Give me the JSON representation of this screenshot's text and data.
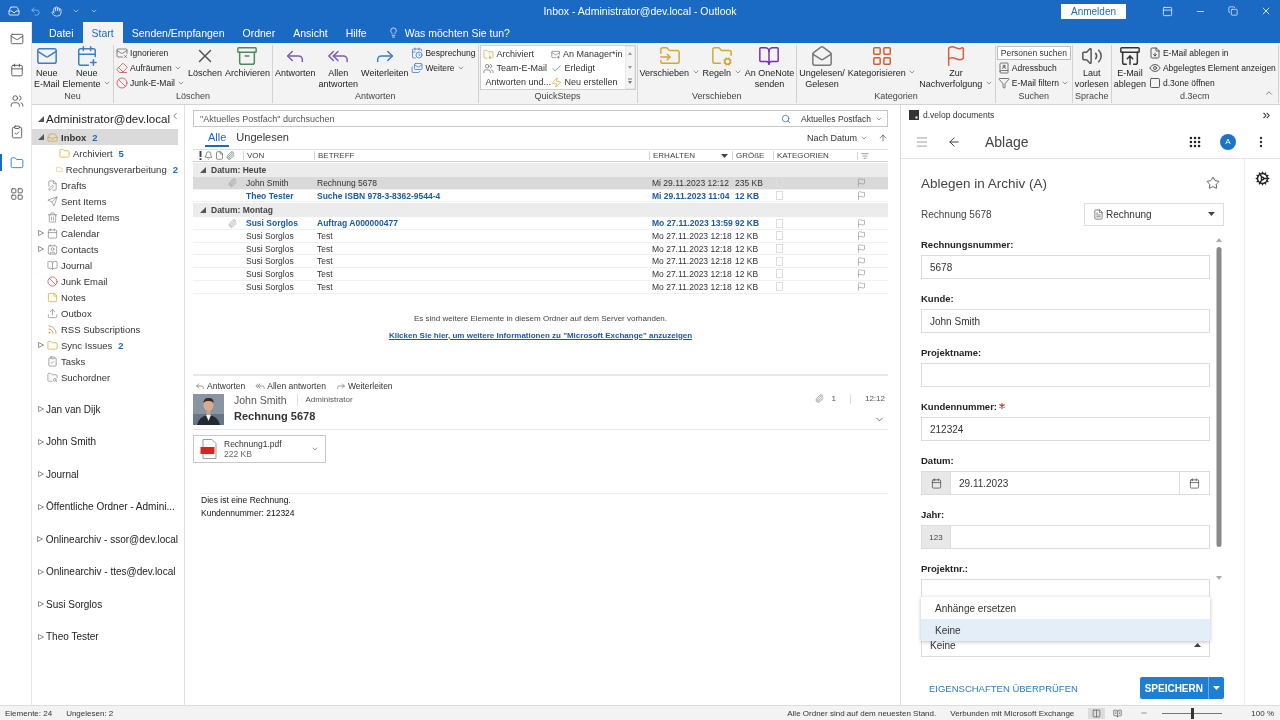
{
  "title_bar": {
    "title": "Inbox - Administrator@dev.local - Outlook",
    "sign_in": "Anmelden"
  },
  "ribbon": {
    "tabs": [
      {
        "label": "Datei",
        "selected": false
      },
      {
        "label": "Start",
        "selected": true
      },
      {
        "label": "Senden/Empfangen",
        "selected": false
      },
      {
        "label": "Ordner",
        "selected": false
      },
      {
        "label": "Ansicht",
        "selected": false
      },
      {
        "label": "Hilfe",
        "selected": false
      }
    ],
    "tell_me": "Was möchten Sie tun?",
    "groups": [
      {
        "name": "Neu",
        "items": [
          {
            "kind": "large",
            "label": "Neue\nE-Mail"
          },
          {
            "kind": "large",
            "label": "Neue\nElemente",
            "dropdown": true
          }
        ]
      },
      {
        "name": "Löschen",
        "items": [
          {
            "kind": "stack",
            "items": [
              {
                "label": "Ignorieren"
              },
              {
                "label": "Aufräumen",
                "dropdown": true
              },
              {
                "label": "Junk-E-Mail",
                "dropdown": true
              }
            ]
          },
          {
            "kind": "large",
            "label": "Löschen"
          },
          {
            "kind": "large",
            "label": "Archivieren"
          }
        ]
      },
      {
        "name": "Antworten",
        "items": [
          {
            "kind": "large",
            "label": "Antworten"
          },
          {
            "kind": "large",
            "label": "Allen\nantworten"
          },
          {
            "kind": "large",
            "label": "Weiterleiten"
          },
          {
            "kind": "stack",
            "items": [
              {
                "label": "Besprechung"
              },
              {
                "label": "Weitere",
                "dropdown": true
              }
            ]
          }
        ]
      },
      {
        "name": "QuickSteps",
        "items": [
          {
            "kind": "gallery",
            "items": [
              {
                "label": "Archiviert"
              },
              {
                "label": "Team-E-Mail"
              },
              {
                "label": "Antworten und..."
              },
              {
                "label": "An Manager*in"
              },
              {
                "label": "Erledigt"
              },
              {
                "label": "Neu erstellen"
              }
            ]
          }
        ]
      },
      {
        "name": "Verschieben",
        "items": [
          {
            "kind": "large",
            "label": "Verschieben",
            "dropdown": true
          },
          {
            "kind": "large",
            "label": "Regeln",
            "dropdown": true
          },
          {
            "kind": "large",
            "label": "An OneNote\nsenden"
          }
        ]
      },
      {
        "name": "Kategorien",
        "items": [
          {
            "kind": "large",
            "label": "Ungelesen/\nGelesen"
          },
          {
            "kind": "large",
            "label": "Kategorisieren",
            "dropdown": true
          },
          {
            "kind": "large",
            "label": "Zur\nNachverfolgung",
            "dropdown": true
          }
        ]
      },
      {
        "name": "Suchen",
        "items": [
          {
            "kind": "stack",
            "items": [
              {
                "kind": "field",
                "placeholder": "Personen suchen"
              },
              {
                "label": "Adressbuch"
              },
              {
                "label": "E-Mail filtern",
                "dropdown": true
              }
            ]
          }
        ]
      },
      {
        "name": "Sprache",
        "items": [
          {
            "kind": "large",
            "label": "Laut\nvorlesen"
          }
        ]
      },
      {
        "name": "d.3ecm",
        "items": [
          {
            "kind": "large",
            "label": "E-Mail\nablegen"
          },
          {
            "kind": "stack",
            "items": [
              {
                "label": "E-Mail ablegen in"
              },
              {
                "label": "Abgelegtes Element anzeigen"
              },
              {
                "label": "d.3one öffnen"
              }
            ]
          }
        ]
      }
    ]
  },
  "folders": {
    "accounts": [
      {
        "name": "Administrator@dev.local",
        "expanded": true,
        "children": [
          {
            "name": "Inbox",
            "count": "2",
            "selected": true,
            "expanded": true,
            "children": [
              {
                "name": "Archiviert",
                "count": "5",
                "selected": false
              },
              {
                "name": "Rechnungsverarbeitung",
                "count": "2",
                "selected": false
              }
            ]
          },
          {
            "name": "Drafts",
            "selected": false
          },
          {
            "name": "Sent Items",
            "selected": false
          },
          {
            "name": "Deleted Items",
            "selected": false
          },
          {
            "name": "Calendar",
            "selected": false,
            "expanded": false
          },
          {
            "name": "Contacts",
            "selected": false,
            "expanded": false
          },
          {
            "name": "Journal",
            "selected": false
          },
          {
            "name": "Junk Email",
            "selected": false
          },
          {
            "name": "Notes",
            "selected": false
          },
          {
            "name": "Outbox",
            "selected": false
          },
          {
            "name": "RSS Subscriptions",
            "selected": false
          },
          {
            "name": "Sync Issues",
            "count": "2",
            "selected": false,
            "expanded": false
          },
          {
            "name": "Tasks",
            "selected": false
          },
          {
            "name": "Suchordner",
            "selected": false
          }
        ]
      },
      {
        "name": "Jan van Dijk",
        "expanded": false
      },
      {
        "name": "John Smith",
        "expanded": false
      },
      {
        "name": "Journal",
        "expanded": false
      },
      {
        "name": "Öffentliche Ordner - Admini...",
        "expanded": false
      },
      {
        "name": "Onlinearchiv - ssor@dev.local",
        "expanded": false
      },
      {
        "name": "Onlinearchiv - ttes@dev.local",
        "expanded": false
      },
      {
        "name": "Susi Sorglos",
        "expanded": false
      },
      {
        "name": "Theo Tester",
        "expanded": false
      }
    ]
  },
  "messages": {
    "search": {
      "placeholder": "\"Aktuelles Postfach\" durchsuchen",
      "scope": "Aktuelles Postfach"
    },
    "filters": [
      {
        "label": "Alle",
        "selected": true
      },
      {
        "label": "Ungelesen",
        "selected": false
      }
    ],
    "sort": "Nach Datum",
    "columns": [
      "VON",
      "BETREFF",
      "ERHALTEN",
      "GRÖßE",
      "KATEGORIEN"
    ],
    "groups": [
      {
        "label": "Datum: Heute",
        "expanded": true,
        "rows": [
          {
            "from": "John Smith",
            "subject": "Rechnung 5678",
            "received": "Mi 29.11.2023 12:12",
            "size": "235 KB",
            "attachment": true,
            "unread": false,
            "selected": true
          },
          {
            "from": "Theo Tester",
            "subject": "Suche ISBN 978-3-8362-9544-4",
            "received": "Mi 29.11.2023 11:04",
            "size": "12 KB",
            "attachment": false,
            "unread": true,
            "selected": false
          }
        ]
      },
      {
        "label": "Datum: Montag",
        "expanded": true,
        "rows": [
          {
            "from": "Susi Sorglos",
            "subject": "Auftrag A000000477",
            "received": "Mo 27.11.2023 13:59",
            "size": "92 KB",
            "attachment": true,
            "unread": true,
            "selected": false
          },
          {
            "from": "Susi Sorglos",
            "subject": "Test",
            "received": "Mo 27.11.2023 12:18",
            "size": "12 KB",
            "attachment": false,
            "unread": false,
            "selected": false
          },
          {
            "from": "Susi Sorglos",
            "subject": "Test",
            "received": "Mo 27.11.2023 12:18",
            "size": "12 KB",
            "attachment": false,
            "unread": false,
            "selected": false
          },
          {
            "from": "Susi Sorglos",
            "subject": "Test",
            "received": "Mo 27.11.2023 12:18",
            "size": "12 KB",
            "attachment": false,
            "unread": false,
            "selected": false
          },
          {
            "from": "Susi Sorglos",
            "subject": "Test",
            "received": "Mo 27.11.2023 12:18",
            "size": "12 KB",
            "attachment": false,
            "unread": false,
            "selected": false
          },
          {
            "from": "Susi Sorglos",
            "subject": "Test",
            "received": "Mo 27.11.2023 12:18",
            "size": "12 KB",
            "attachment": false,
            "unread": false,
            "selected": false
          }
        ]
      }
    ],
    "notice": "Es sind weitere Elemente in diesem Ordner auf dem Server vorhanden.",
    "link": "Klicken Sie hier, um weitere Informationen zu \"Microsoft Exchange\" anzuzeigen"
  },
  "reading_pane": {
    "actions": [
      "Antworten",
      "Allen antworten",
      "Weiterleiten"
    ],
    "sender": "John Smith",
    "recipient": "Administrator",
    "attachment_count": "1",
    "time": "12:12",
    "subject": "Rechnung 5678",
    "attachment": {
      "name": "Rechnung1.pdf",
      "size": "222 KB"
    },
    "body": [
      "Dies ist eine Rechnung.",
      "Kundennummer: 212324"
    ]
  },
  "addin": {
    "title": "d.velop documents",
    "toolbar_title": "Ablage",
    "avatar": "A",
    "form_title": "Ablegen in Archiv (A)",
    "document": "Rechnung 5678",
    "category": "Rechnung",
    "fields": [
      {
        "kind": "text",
        "label": "Rechnungsnummer:",
        "value": "5678",
        "required": false
      },
      {
        "kind": "text",
        "label": "Kunde:",
        "value": "John Smith",
        "required": false
      },
      {
        "kind": "text",
        "label": "Projektname:",
        "required": false
      },
      {
        "kind": "text",
        "label": "Kundennummer:",
        "value": "212324",
        "required": true
      },
      {
        "kind": "date",
        "label": "Datum:",
        "value": "29.11.2023",
        "required": false
      },
      {
        "kind": "number",
        "label": "Jahr:",
        "prefix": "123",
        "required": false
      },
      {
        "kind": "text",
        "label": "Projektnr.:",
        "required": false
      },
      {
        "kind": "select",
        "value": "Keine",
        "expanded": true,
        "options": [
          {
            "label": "Anhänge ersetzen",
            "selected": false
          },
          {
            "label": "Keine",
            "selected": true
          }
        ]
      }
    ],
    "check_link": "EIGENSCHAFTEN ÜBERPRÜFEN",
    "save": "SPEICHERN"
  },
  "status_bar": {
    "items": "Elemente: 24",
    "unread": "Ungelesen: 2",
    "sync": "Alle Ordner sind auf dem neuesten Stand.",
    "connection": "Verbunden mit Microsoft Exchange",
    "zoom": {
      "level": 0.5,
      "reading": "100 %"
    }
  }
}
